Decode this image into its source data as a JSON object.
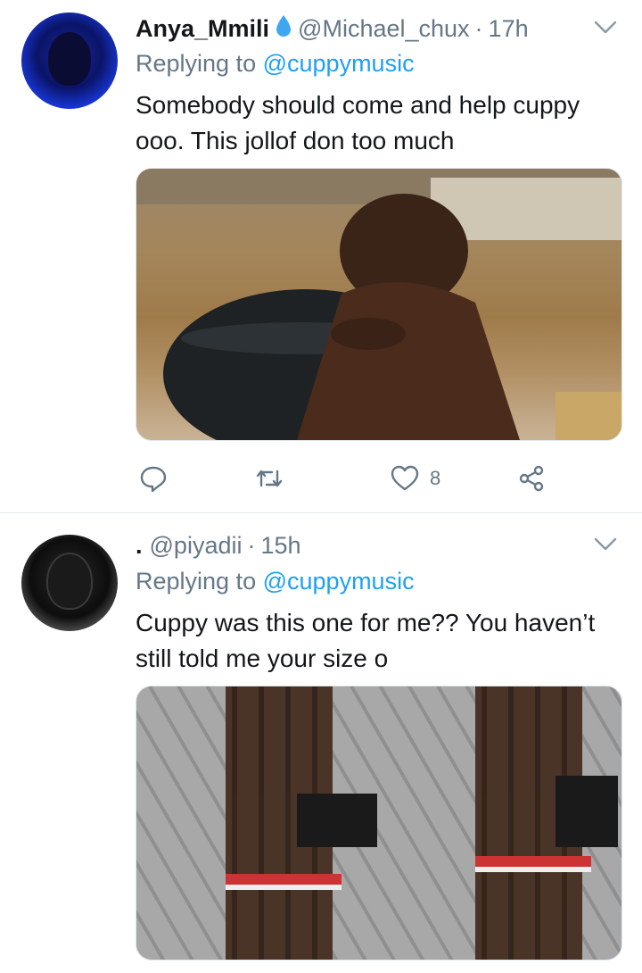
{
  "tweets": [
    {
      "display_name": "Anya_Mmili",
      "name_emoji": "💧",
      "handle": "@Michael_chux",
      "separator": "·",
      "time": "17h",
      "replying_prefix": "Replying to",
      "replying_to": "@cuppymusic",
      "text": "Somebody should come and help cuppy ooo.  This jollof don too much",
      "like_count": "8"
    },
    {
      "display_name": ".",
      "handle": "@piyadii",
      "separator": "·",
      "time": "15h",
      "replying_prefix": "Replying to",
      "replying_to": "@cuppymusic",
      "text": "Cuppy was this one for me?? You haven’t still told me your size o"
    }
  ],
  "icons": [
    "reply-icon",
    "retweet-icon",
    "like-icon",
    "share-icon",
    "chevron-down-icon"
  ],
  "colors": {
    "link": "#1da1f2",
    "muted": "#657786",
    "text": "#14171a",
    "divider": "#e1e8ed"
  }
}
